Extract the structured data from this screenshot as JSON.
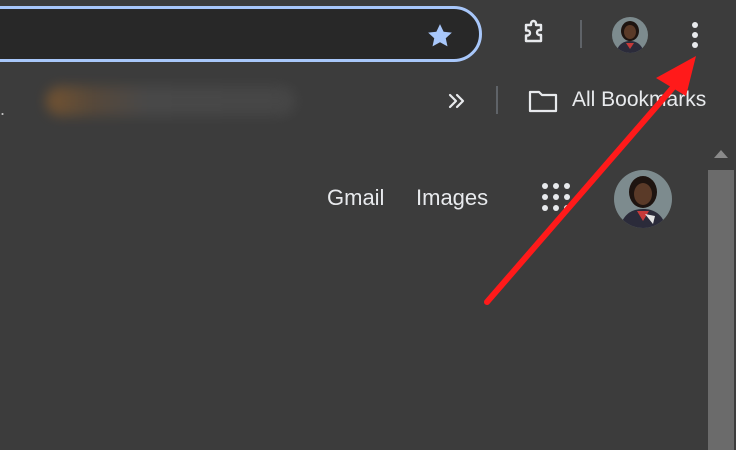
{
  "toolbar": {
    "icons": {
      "star": "star-icon",
      "extensions": "puzzle-piece-icon",
      "profile": "avatar",
      "menu": "three-dot-menu-icon"
    },
    "colors": {
      "omnibox_border": "#a8c7fa",
      "star": "#a8c7fa"
    }
  },
  "bookmarks_bar": {
    "overflow_indicator": ".",
    "more_chevron": "»",
    "all_bookmarks_label": "All Bookmarks"
  },
  "page": {
    "gmail_label": "Gmail",
    "images_label": "Images",
    "apps_icon": "google-apps-grid-icon"
  },
  "annotation": {
    "arrow_color": "#ff1a1a",
    "points_to": "three-dot-menu-icon"
  }
}
